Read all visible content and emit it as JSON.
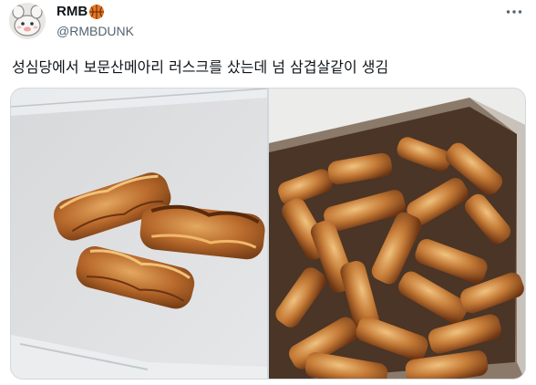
{
  "user": {
    "display_name": "RMB",
    "handle": "@RMBDUNK",
    "badge_icon": "basketball-icon",
    "avatar_icon": "cartoon-avatar-icon"
  },
  "tweet": {
    "text": "성심당에서 보문산메아리 러스크를 샀는데 넘 삼겹살같이 생김"
  },
  "media": {
    "photos": [
      {
        "name": "three-rusk-pieces-photo"
      },
      {
        "name": "rusk-box-photo"
      }
    ]
  },
  "colors": {
    "text": "#0f1419",
    "secondary": "#536471",
    "border": "#cfd9de",
    "badge": "#e87722"
  }
}
